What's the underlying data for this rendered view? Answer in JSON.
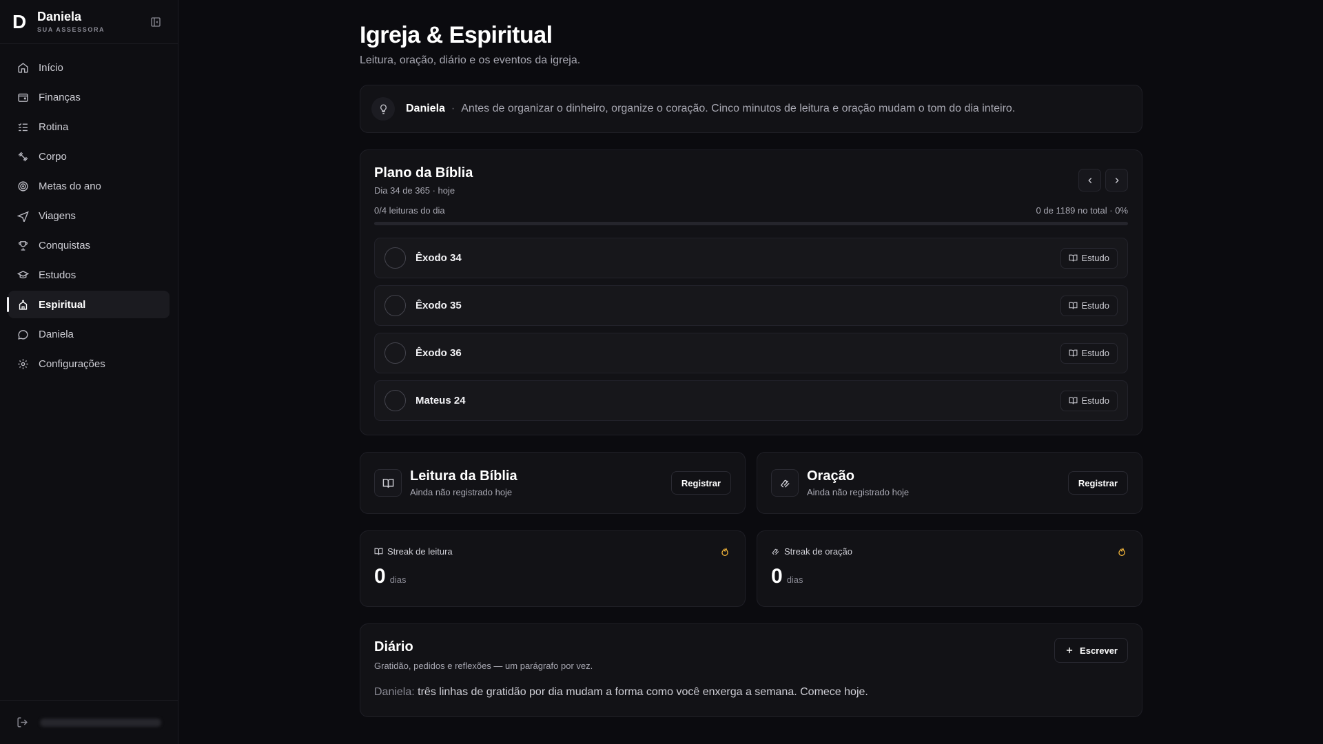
{
  "brand": {
    "logo": "D",
    "name": "Daniela",
    "subtitle": "SUA ASSESSORA"
  },
  "sidebar": {
    "items": [
      {
        "label": "Início",
        "icon": "home-icon"
      },
      {
        "label": "Finanças",
        "icon": "wallet-icon"
      },
      {
        "label": "Rotina",
        "icon": "list-checks-icon"
      },
      {
        "label": "Corpo",
        "icon": "dumbbell-icon"
      },
      {
        "label": "Metas do ano",
        "icon": "target-icon"
      },
      {
        "label": "Viagens",
        "icon": "plane-icon"
      },
      {
        "label": "Conquistas",
        "icon": "trophy-icon"
      },
      {
        "label": "Estudos",
        "icon": "graduation-cap-icon"
      },
      {
        "label": "Espiritual",
        "icon": "church-icon",
        "active": true
      },
      {
        "label": "Daniela",
        "icon": "chat-bubble-icon"
      },
      {
        "label": "Configurações",
        "icon": "gear-icon"
      }
    ]
  },
  "page": {
    "title": "Igreja & Espiritual",
    "subtitle": "Leitura, oração, diário e os eventos da igreja."
  },
  "tip": {
    "name": "Daniela",
    "separator": "·",
    "text": "Antes de organizar o dinheiro, organize o coração. Cinco minutos de leitura e oração mudam o tom do dia inteiro."
  },
  "plan": {
    "title": "Plano da Bíblia",
    "subtitle": "Dia 34 de 365 · hoje",
    "progress_left": "0/4 leituras do dia",
    "progress_right": "0 de 1189 no total · 0%",
    "progress_percent": 0,
    "study_label": "Estudo",
    "readings": [
      {
        "label": "Êxodo 34"
      },
      {
        "label": "Êxodo 35"
      },
      {
        "label": "Êxodo 36"
      },
      {
        "label": "Mateus 24"
      }
    ]
  },
  "log": {
    "bible": {
      "title": "Leitura da Bíblia",
      "subtitle": "Ainda não registrado hoje",
      "button": "Registrar"
    },
    "prayer": {
      "title": "Oração",
      "subtitle": "Ainda não registrado hoje",
      "button": "Registrar"
    }
  },
  "streaks": {
    "reading": {
      "label": "Streak de leitura",
      "value": "0",
      "unit": "dias"
    },
    "prayer": {
      "label": "Streak de oração",
      "value": "0",
      "unit": "dias"
    }
  },
  "diary": {
    "title": "Diário",
    "subtitle": "Gratidão, pedidos e reflexões — um parágrafo por vez.",
    "button": "Escrever",
    "quote_who": "Daniela:",
    "quote_text": "três linhas de gratidão por dia mudam a forma como você enxerga a semana. Comece hoje."
  },
  "colors": {
    "background": "#0b0b0f",
    "card": "#121216",
    "accent_flame": "#f5b73b"
  }
}
